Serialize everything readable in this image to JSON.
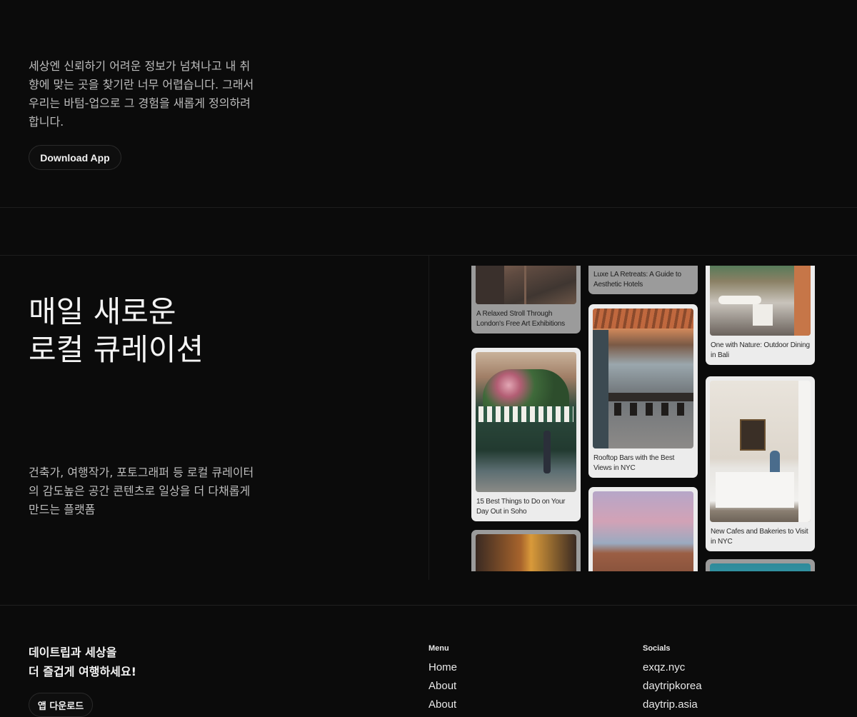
{
  "intro": {
    "text": "세상엔 신뢰하기 어려운 정보가 넘쳐나고 내 취향에 맞는 곳을 찾기란 너무 어렵습니다. 그래서 우리는 바텀-업으로 그 경험을 새롭게 정의하려 합니다.",
    "download_label": "Download App"
  },
  "hero": {
    "headline_line1": "매일 새로운",
    "headline_line2": "로컬 큐레이션",
    "sub_text": "건축가, 여행작가, 포토그래퍼 등 로컬 큐레이터의 감도높은 공간 콘텐츠로 일상을 더 다채롭게 만드는 플랫폼"
  },
  "gallery": {
    "col1": [
      {
        "caption": "A Relaxed Stroll Through London's Free Art Exhibitions",
        "dim": true
      },
      {
        "caption": "15 Best Things to Do on Your Day Out in Soho",
        "dim": false
      },
      {
        "caption": "",
        "dim": true
      }
    ],
    "col2": [
      {
        "caption": "Luxe LA Retreats: A Guide to Aesthetic Hotels",
        "dim": true
      },
      {
        "caption": "Rooftop Bars with the Best Views in NYC",
        "dim": false
      },
      {
        "caption": "",
        "dim": false
      }
    ],
    "col3": [
      {
        "caption": "One with Nature: Outdoor Dining in Bali",
        "dim": false
      },
      {
        "caption": "New Cafes and Bakeries to Visit in NYC",
        "dim": false
      },
      {
        "caption": "",
        "dim": true
      }
    ]
  },
  "footer": {
    "tagline_line1": "데이트립과 세상을",
    "tagline_line2": "더 즐겁게 여행하세요!",
    "app_download_label": "앱 다운로드",
    "menu": {
      "heading": "Menu",
      "links": [
        "Home",
        "About",
        "About"
      ]
    },
    "socials": {
      "heading": "Socials",
      "links": [
        "exqz.nyc",
        "daytripkorea",
        "daytrip.asia"
      ]
    }
  }
}
